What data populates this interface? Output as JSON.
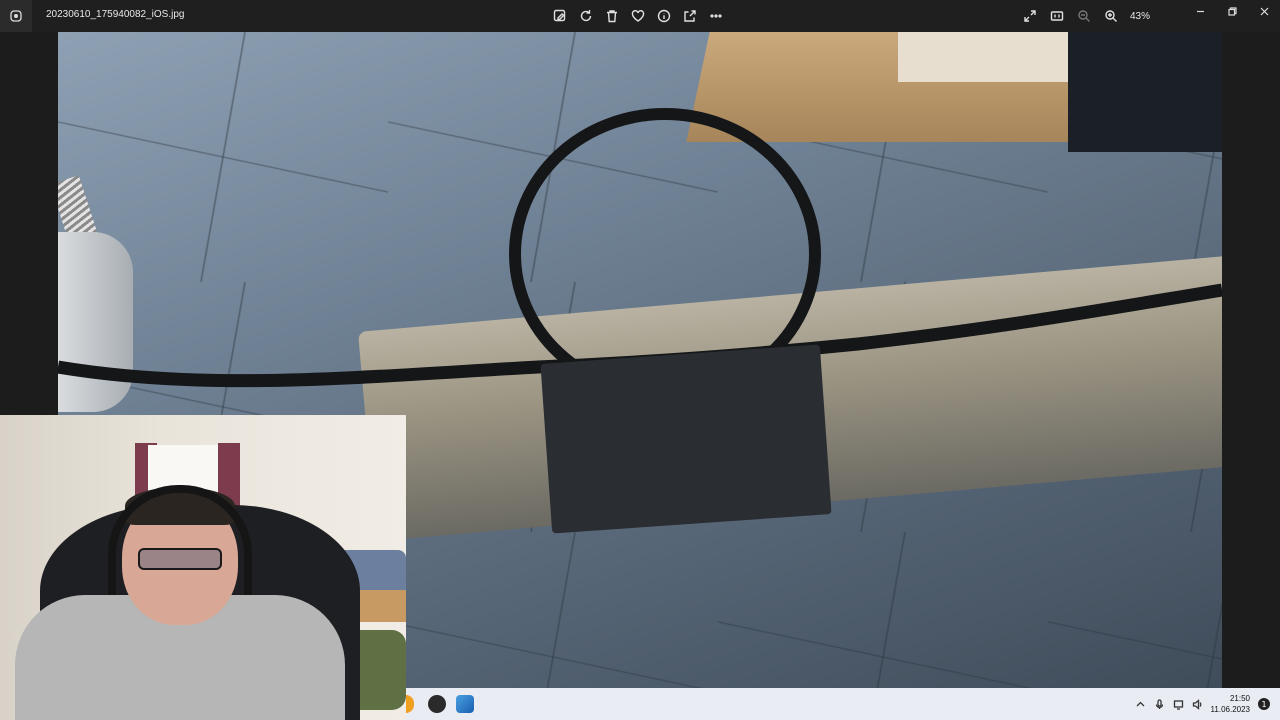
{
  "window": {
    "file_name": "20230610_175940082_iOS.jpg",
    "zoom_level": "43%"
  },
  "toolbar": {
    "items": [
      "edit-icon",
      "rotate-icon",
      "delete-icon",
      "favorite-icon",
      "info-icon",
      "share-icon",
      "more-icon"
    ]
  },
  "right_tools": {
    "items": [
      "expand-icon",
      "actual-size-icon",
      "zoom-out-icon",
      "zoom-in-icon"
    ]
  },
  "taskbar": {
    "time": "21:50",
    "date": "11.06.2023",
    "notification_count": "1"
  },
  "colors": {
    "titlebar": "#1f1f1f",
    "taskbar": "#e9edf3"
  }
}
